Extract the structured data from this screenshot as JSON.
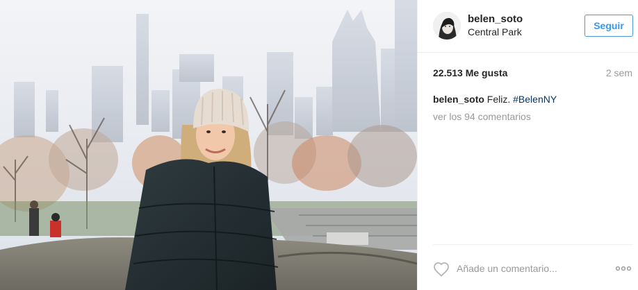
{
  "post": {
    "photo_alt": "",
    "author": {
      "username": "belen_soto",
      "location": "Central Park",
      "follow_label": "Seguir"
    },
    "likes_text": "22.513 Me gusta",
    "time_text": "2 sem",
    "caption": {
      "username": "belen_soto",
      "text": "Feliz.",
      "hashtag": "#BelenNY"
    },
    "view_comments_text": "ver los 94 comentarios",
    "comment_box": {
      "placeholder": "Añade un comentario..."
    }
  },
  "icons": {
    "like": "heart-icon",
    "more": "more-options-icon",
    "avatar": "avatar"
  },
  "colors": {
    "follow_border": "#4c9ad8",
    "follow_text": "#3897f0",
    "hashtag": "#003569",
    "muted": "#999999"
  }
}
